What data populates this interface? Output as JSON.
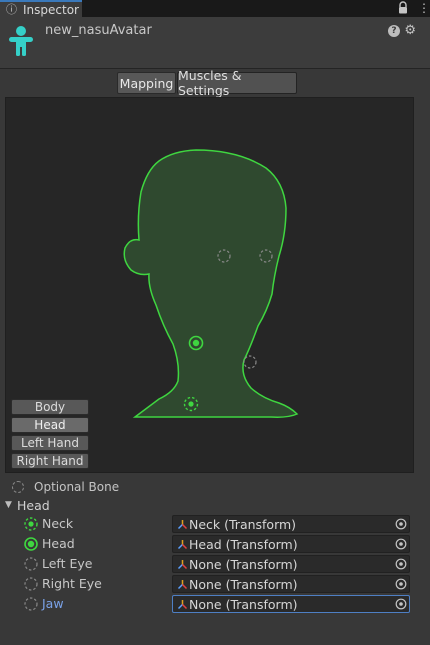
{
  "tab": {
    "label": "Inspector"
  },
  "header": {
    "object_name": "new_nasuAvatar"
  },
  "mode_tabs": {
    "mapping": "Mapping",
    "muscles": "Muscles & Settings"
  },
  "body_parts": [
    "Body",
    "Head",
    "Left Hand",
    "Right Hand"
  ],
  "selected_body_part": "Head",
  "optional_bone_label": "Optional Bone",
  "section": {
    "label": "Head"
  },
  "bones": [
    {
      "label": "Neck",
      "value": "Neck (Transform)",
      "state": "dashed-green"
    },
    {
      "label": "Head",
      "value": "Head (Transform)",
      "state": "filled-green"
    },
    {
      "label": "Left Eye",
      "value": "None (Transform)",
      "state": "empty"
    },
    {
      "label": "Right Eye",
      "value": "None (Transform)",
      "state": "empty"
    },
    {
      "label": "Jaw",
      "value": "None (Transform)",
      "state": "empty-selected"
    }
  ],
  "colors": {
    "accent_green": "#3fd640",
    "head_fill": "#2f492f",
    "selection_blue": "#7aa2e8",
    "focus_border": "#4e7fc4"
  }
}
